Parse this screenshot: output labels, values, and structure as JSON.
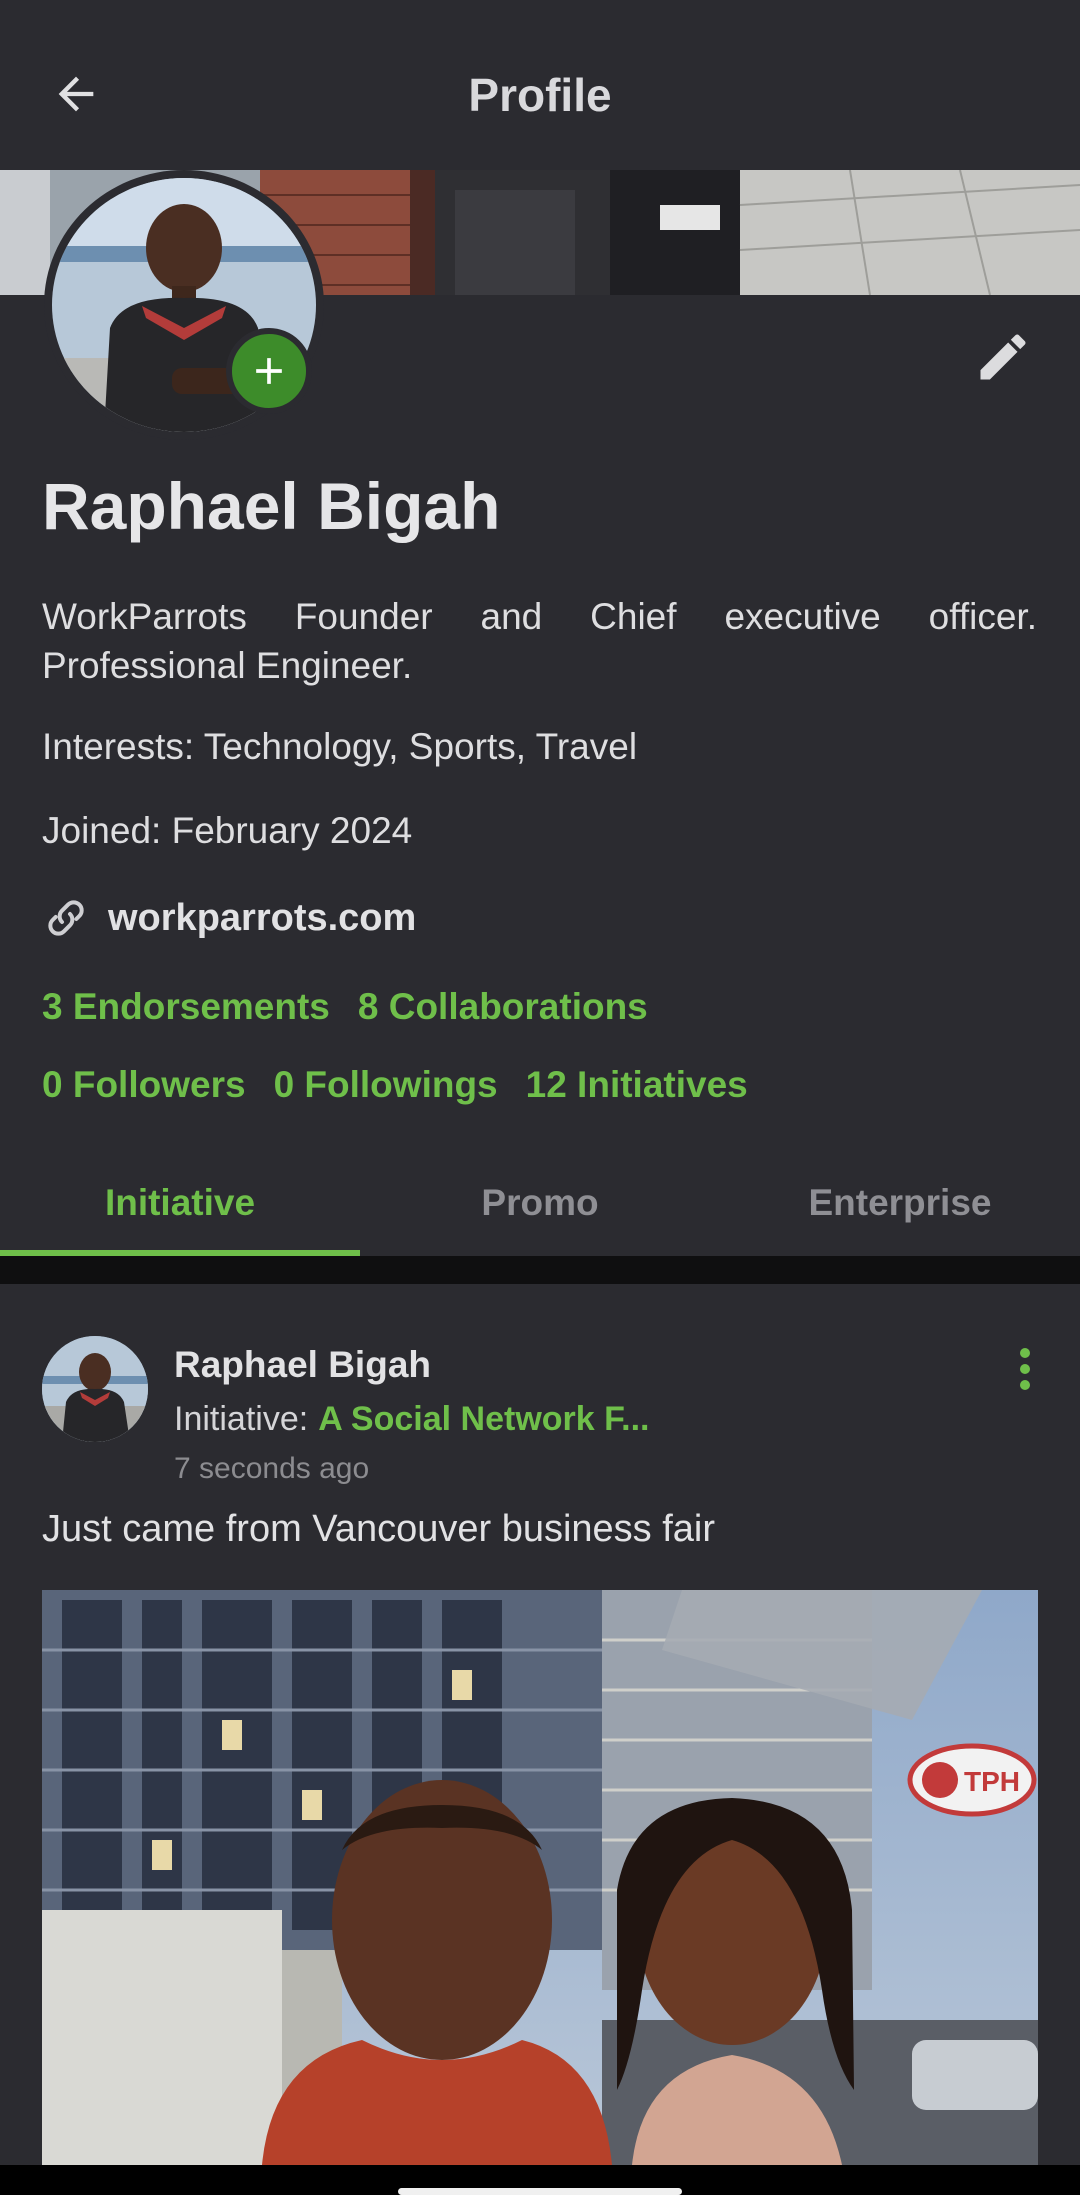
{
  "appbar": {
    "title": "Profile",
    "back_icon": "arrow-left-icon"
  },
  "profile": {
    "name": "Raphael Bigah",
    "bio": "WorkParrots Founder and Chief executive officer. Professional Engineer.",
    "interests": "Interests: Technology, Sports, Travel",
    "joined": "Joined: February 2024",
    "website": "workparrots.com",
    "add_icon": "plus-icon",
    "edit_icon": "pencil-icon",
    "link_icon": "link-icon"
  },
  "stats": {
    "endorsements": "3 Endorsements",
    "collaborations": "8 Collaborations",
    "followers": "0 Followers",
    "followings": "0 Followings",
    "initiatives": "12 Initiatives"
  },
  "tabs": [
    {
      "label": "Initiative",
      "active": true
    },
    {
      "label": "Promo",
      "active": false
    },
    {
      "label": "Enterprise",
      "active": false
    }
  ],
  "post": {
    "author": "Raphael Bigah",
    "initiative_label": "Initiative:",
    "initiative_name": "A Social Network F...",
    "time": "7 seconds ago",
    "text": "Just came from Vancouver business fair",
    "more_icon": "more-vertical-icon",
    "sign_text": "TPH"
  },
  "colors": {
    "accent": "#6fbf4a",
    "background": "#2b2b30",
    "badge": "#3d8c2a"
  }
}
